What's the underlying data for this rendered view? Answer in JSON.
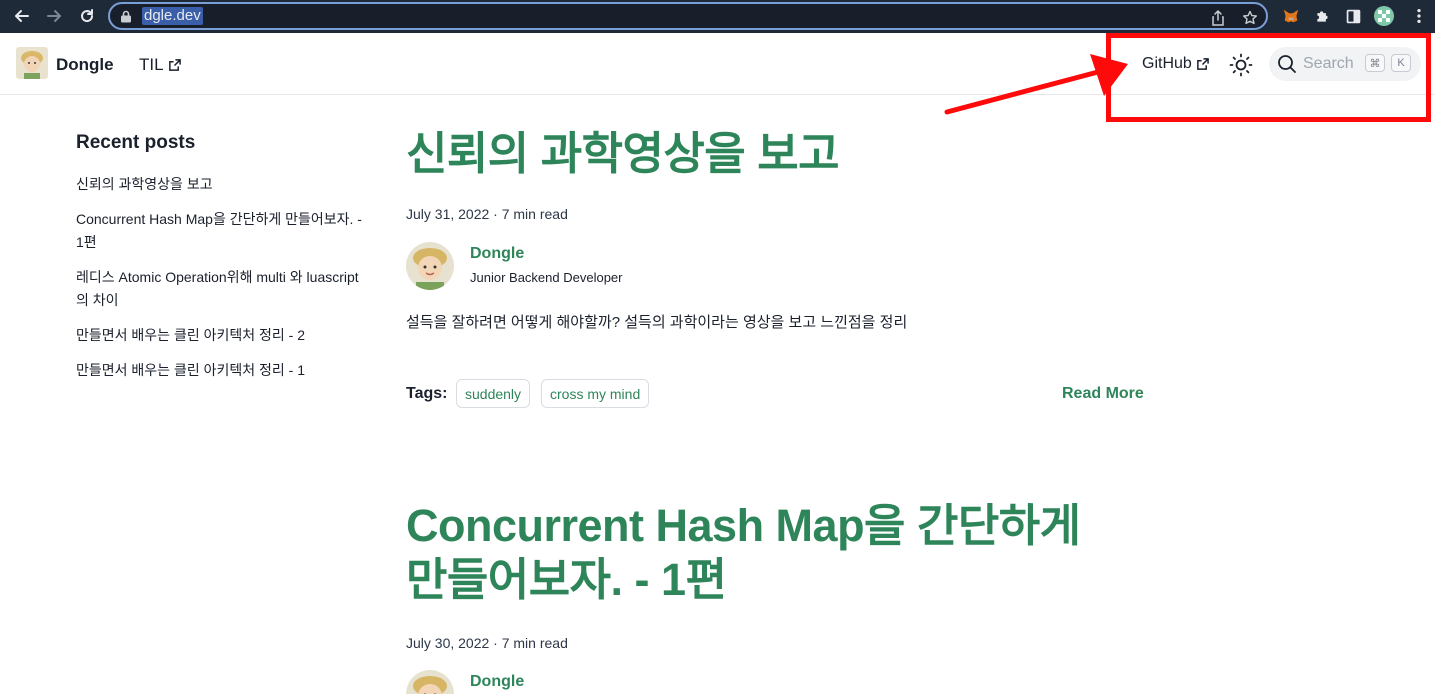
{
  "browser": {
    "url": "dgle.dev"
  },
  "header": {
    "site_name": "Dongle",
    "nav": [
      {
        "label": "TIL"
      },
      {
        "label": "GitHub"
      }
    ],
    "search": {
      "placeholder": "Search",
      "shortcut_mod": "⌘",
      "shortcut_key": "K"
    }
  },
  "sidebar": {
    "heading": "Recent posts",
    "items": [
      {
        "line1": "신뢰의 과학영상을 보고",
        "line2": ""
      },
      {
        "line1": "Concurrent Hash Map을 간단하게 만들어보자. -",
        "line2": "1편"
      },
      {
        "line1": "레디스 Atomic Operation위해 multi 와 luascript",
        "line2": "의 차이"
      },
      {
        "line1": "만들면서 배우는 클린 아키텍처 정리 - 2",
        "line2": ""
      },
      {
        "line1": "만들면서 배우는 클린 아키텍처 정리 - 1",
        "line2": ""
      }
    ]
  },
  "posts": [
    {
      "title_line1": "신뢰의 과학영상을 보고",
      "title_line2": "",
      "meta": "July 31, 2022 · 7 min read",
      "author": "Dongle",
      "role": "Junior Backend Developer",
      "excerpt": "설득을 잘하려면 어떻게 해야할까? 설득의 과학이라는 영상을 보고 느낀점을 정리",
      "tags_label": "Tags:",
      "tags": [
        "suddenly",
        "cross my mind"
      ],
      "read_more": "Read More"
    },
    {
      "title_line1": "Concurrent Hash Map을 간단하게",
      "title_line2": "만들어보자. - 1편",
      "meta": "July 30, 2022 · 7 min read",
      "author": "Dongle"
    }
  ],
  "colors": {
    "accent": "#2f855a",
    "annotation": "#ff0a0a",
    "chrome_bg": "#1f2a39"
  }
}
